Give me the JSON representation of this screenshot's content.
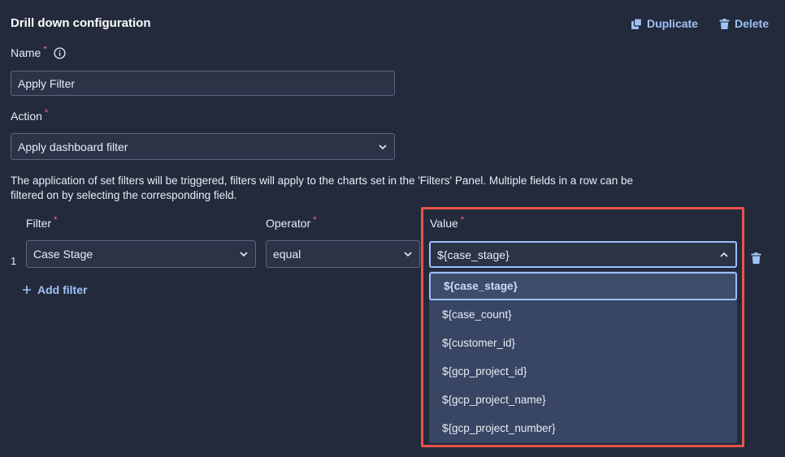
{
  "header": {
    "title": "Drill down configuration",
    "duplicate_label": "Duplicate",
    "delete_label": "Delete"
  },
  "name_field": {
    "label": "Name",
    "required_mark": "*",
    "value": "Apply Filter"
  },
  "action_field": {
    "label": "Action",
    "required_mark": "*",
    "selected": "Apply dashboard filter"
  },
  "description": "The application of set filters will be triggered, filters will apply to the charts set in the 'Filters' Panel. Multiple fields in a row can be filtered on by selecting the corresponding field.",
  "filters": {
    "columns": {
      "filter": "Filter",
      "operator": "Operator",
      "value": "Value",
      "required_mark": "*"
    },
    "rows": [
      {
        "index": "1",
        "filter": "Case Stage",
        "operator": "equal",
        "value": "${case_stage}"
      }
    ],
    "add_label": "Add filter"
  },
  "value_dropdown": {
    "options": [
      "${case_stage}",
      "${case_count}",
      "${customer_id}",
      "${gcp_project_id}",
      "${gcp_project_name}",
      "${gcp_project_number}"
    ],
    "selected_index": 0
  },
  "colors": {
    "background": "#232a3c",
    "accent": "#9fc2f5",
    "required": "#f07878",
    "highlight_box": "#e8534a",
    "dropdown_bg": "#384563"
  }
}
